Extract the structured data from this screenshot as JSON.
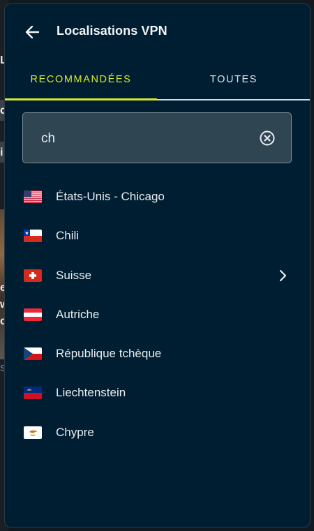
{
  "header": {
    "title": "Localisations VPN",
    "back_icon": "arrow-left-icon"
  },
  "tabs": [
    {
      "label": "RECOMMANDÉES",
      "active": true
    },
    {
      "label": "TOUTES",
      "active": false
    }
  ],
  "search": {
    "value": "ch",
    "clear_icon": "clear-circle-icon"
  },
  "locations": [
    {
      "label": "États-Unis - Chicago",
      "flag": "us",
      "has_submenu": false
    },
    {
      "label": "Chili",
      "flag": "cl",
      "has_submenu": false
    },
    {
      "label": "Suisse",
      "flag": "ch",
      "has_submenu": true
    },
    {
      "label": "Autriche",
      "flag": "at",
      "has_submenu": false
    },
    {
      "label": "République tchèque",
      "flag": "cz",
      "has_submenu": false
    },
    {
      "label": "Liechtenstein",
      "flag": "li",
      "has_submenu": false
    },
    {
      "label": "Chypre",
      "flag": "cy",
      "has_submenu": false
    }
  ],
  "background_fragments": [
    "L",
    "c",
    "i",
    "e",
    "w",
    "c",
    "S"
  ],
  "colors": {
    "panel_bg": "#001e31",
    "accent": "#d8e832",
    "search_bg": "#2f4552",
    "text": "#e8edf0"
  }
}
